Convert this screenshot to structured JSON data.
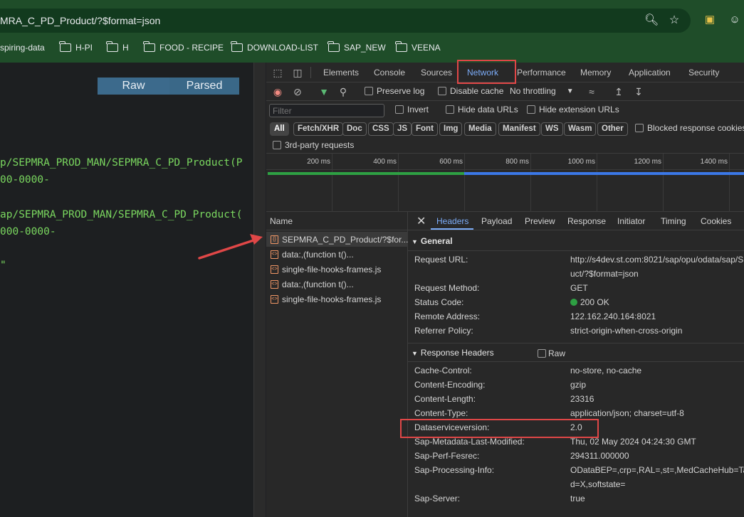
{
  "browser": {
    "url": "MRA_C_PD_Product/?$format=json",
    "icons": [
      "zoom-icon",
      "bookmark-star-icon",
      "extension-icon",
      "profile-icon"
    ]
  },
  "bookmarks": [
    {
      "label": "spiring-data",
      "folder": false
    },
    {
      "label": "H-PI",
      "folder": true
    },
    {
      "label": "H",
      "folder": true
    },
    {
      "label": "FOOD - RECIPE",
      "folder": true
    },
    {
      "label": "DOWNLOAD-LIST",
      "folder": true
    },
    {
      "label": "SAP_NEW",
      "folder": true
    },
    {
      "label": "VEENA",
      "folder": true
    }
  ],
  "page": {
    "raw_label": "Raw",
    "parsed_label": "Parsed",
    "code_lines": [
      "p/SEPMRA_PROD_MAN/SEPMRA_C_PD_Product(P",
      "00-0000-",
      "ap/SEPMRA_PROD_MAN/SEPMRA_C_PD_Product(",
      "000-0000-",
      "\""
    ]
  },
  "devtools": {
    "tabs": [
      "Elements",
      "Console",
      "Sources",
      "Network",
      "Performance",
      "Memory",
      "Application",
      "Security"
    ],
    "active_tab": "Network",
    "toolbar": {
      "preserve_log": "Preserve log",
      "disable_cache": "Disable cache",
      "throttling": "No throttling"
    },
    "filter": {
      "placeholder": "Filter",
      "invert": "Invert",
      "hide_data_urls": "Hide data URLs",
      "hide_extension_urls": "Hide extension URLs"
    },
    "type_filters": [
      "All",
      "Fetch/XHR",
      "Doc",
      "CSS",
      "JS",
      "Font",
      "Img",
      "Media",
      "Manifest",
      "WS",
      "Wasm",
      "Other"
    ],
    "blocked_cookies": "Blocked response cookies",
    "third_party": "3rd-party requests",
    "timeline_ticks": [
      "200 ms",
      "400 ms",
      "600 ms",
      "800 ms",
      "1000 ms",
      "1200 ms",
      "1400 ms"
    ],
    "list_header": "Name",
    "requests": [
      {
        "name": "SEPMRA_C_PD_Product/?$for...",
        "selected": true
      },
      {
        "name": "data:,(function t()...",
        "selected": false
      },
      {
        "name": "single-file-hooks-frames.js",
        "selected": false
      },
      {
        "name": "data:,(function t()...",
        "selected": false
      },
      {
        "name": "single-file-hooks-frames.js",
        "selected": false
      }
    ],
    "detail_tabs": [
      "Headers",
      "Payload",
      "Preview",
      "Response",
      "Initiator",
      "Timing",
      "Cookies"
    ],
    "active_detail_tab": "Headers",
    "general": {
      "title": "General",
      "rows": [
        {
          "key": "Request URL:",
          "value": "http://s4dev.st.com:8021/sap/opu/odata/sap/S",
          "value2": "uct/?$format=json"
        },
        {
          "key": "Request Method:",
          "value": "GET"
        },
        {
          "key": "Status Code:",
          "value": "200 OK"
        },
        {
          "key": "Remote Address:",
          "value": "122.162.240.164:8021"
        },
        {
          "key": "Referrer Policy:",
          "value": "strict-origin-when-cross-origin"
        }
      ]
    },
    "response_headers": {
      "title": "Response Headers",
      "raw_label": "Raw",
      "rows": [
        {
          "key": "Cache-Control:",
          "value": "no-store, no-cache"
        },
        {
          "key": "Content-Encoding:",
          "value": "gzip"
        },
        {
          "key": "Content-Length:",
          "value": "23316"
        },
        {
          "key": "Content-Type:",
          "value": "application/json; charset=utf-8"
        },
        {
          "key": "Dataserviceversion:",
          "value": "2.0"
        },
        {
          "key": "Sap-Metadata-Last-Modified:",
          "value": "Thu, 02 May 2024 04:24:30 GMT"
        },
        {
          "key": "Sap-Perf-Fesrec:",
          "value": "294311.000000"
        },
        {
          "key": "Sap-Processing-Info:",
          "value": "ODataBEP=,crp=,RAL=,st=,MedCacheHub=Tab",
          "value2": "d=X,softstate="
        },
        {
          "key": "Sap-Server:",
          "value": "true"
        }
      ]
    }
  },
  "colors": {
    "highlight": "#e04747",
    "accent": "#7cacf8",
    "status_ok": "#2ea043"
  }
}
